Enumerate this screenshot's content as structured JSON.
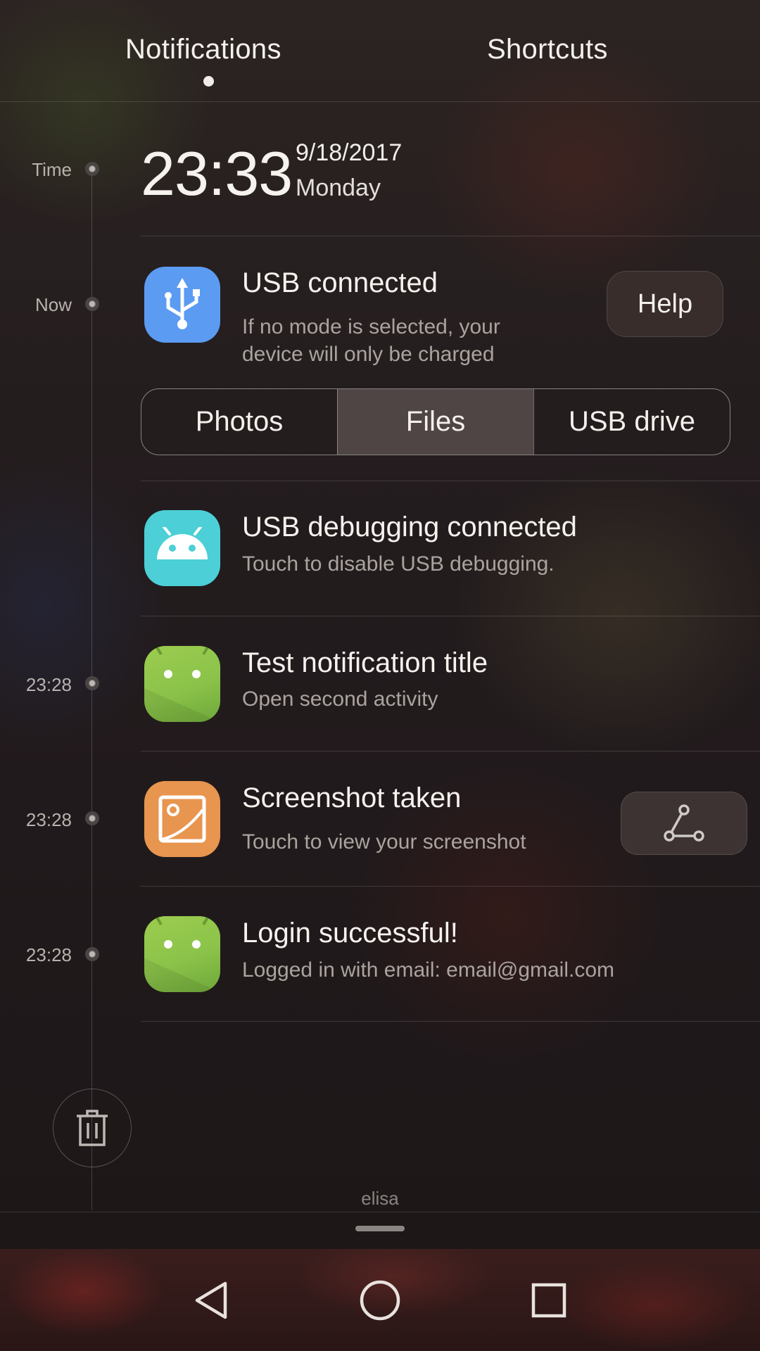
{
  "tabs": {
    "notifications": "Notifications",
    "shortcuts": "Shortcuts",
    "active": "Notifications"
  },
  "timeline": {
    "time_label": "Time",
    "now_label": "Now",
    "stamps": [
      "23:28",
      "23:28",
      "23:28"
    ]
  },
  "clock": {
    "time": "23:33",
    "date": "9/18/2017",
    "weekday": "Monday"
  },
  "notifications": [
    {
      "app_icon": "usb-icon",
      "icon_color": "#5b9bf2",
      "title": "USB connected",
      "body_line1": "If no mode is selected, your",
      "body_line2": "device will only be charged",
      "action": "Help",
      "modes": [
        "Photos",
        "Files",
        "USB drive"
      ],
      "selected_mode": "Files"
    },
    {
      "app_icon": "android-icon",
      "icon_color": "#4ccfd6",
      "title": "USB debugging connected",
      "body": "Touch to disable USB debugging."
    },
    {
      "app_icon": "android-icon",
      "icon_color": "#8bc34a",
      "title": "Test notification title",
      "body": "Open second activity"
    },
    {
      "app_icon": "gallery-icon",
      "icon_color": "#e8954f",
      "title": "Screenshot taken",
      "body": "Touch to view your screenshot",
      "action_icon": "share-icon"
    },
    {
      "app_icon": "android-icon",
      "icon_color": "#8bc34a",
      "title": "Login successful!",
      "body": "Logged in with email: email@gmail.com"
    }
  ],
  "footer": {
    "carrier": "elisa",
    "clear_icon": "trash-icon"
  },
  "navbar": {
    "back_icon": "back-triangle-icon",
    "home_icon": "home-circle-icon",
    "recents_icon": "recents-square-icon"
  }
}
